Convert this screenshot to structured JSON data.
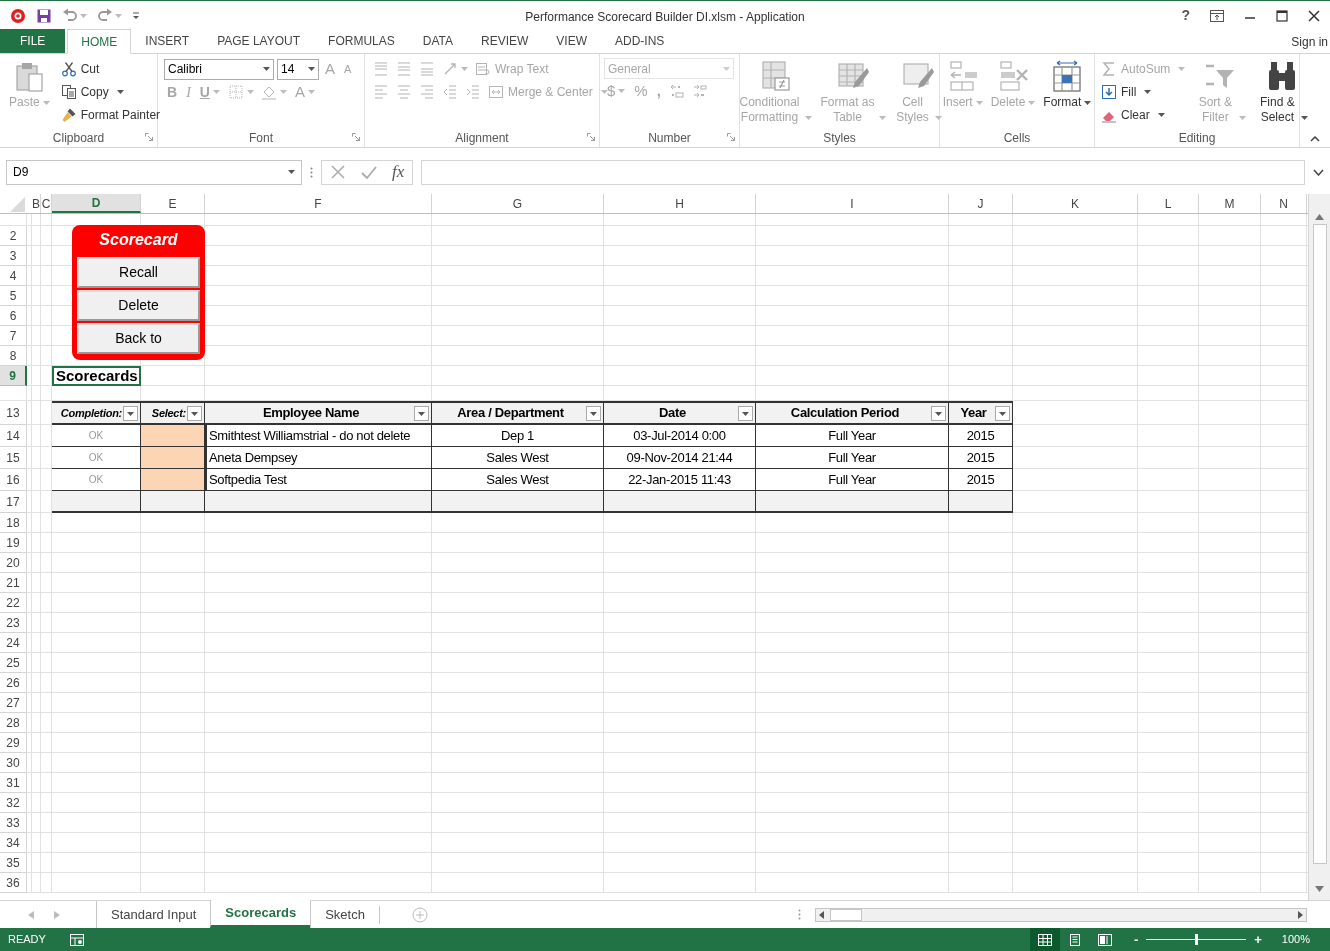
{
  "title_bar": {
    "title": "Performance Scorecard Builder DI.xlsm - Application",
    "help": "?"
  },
  "menu_tabs": [
    {
      "label": "FILE",
      "kind": "file",
      "selected": false
    },
    {
      "label": "HOME",
      "kind": "tab",
      "selected": true
    },
    {
      "label": "INSERT",
      "kind": "tab",
      "selected": false
    },
    {
      "label": "PAGE LAYOUT",
      "kind": "tab",
      "selected": false
    },
    {
      "label": "FORMULAS",
      "kind": "tab",
      "selected": false
    },
    {
      "label": "DATA",
      "kind": "tab",
      "selected": false
    },
    {
      "label": "REVIEW",
      "kind": "tab",
      "selected": false
    },
    {
      "label": "VIEW",
      "kind": "tab",
      "selected": false
    },
    {
      "label": "ADD-INS",
      "kind": "tab",
      "selected": false
    }
  ],
  "sign_in": "Sign in",
  "ribbon": [
    {
      "label": "Clipboard",
      "launcher": true,
      "columns": [
        [
          {
            "kind": "large",
            "label": "Paste",
            "disabled": true,
            "dropdown": true
          }
        ],
        [
          {
            "kind": "small",
            "label": "Cut",
            "disabled": false
          },
          {
            "kind": "small",
            "label": "Copy",
            "disabled": false,
            "dropdown": true
          },
          {
            "kind": "small",
            "label": "Format Painter",
            "disabled": false
          }
        ]
      ]
    },
    {
      "label": "Font",
      "launcher": true,
      "columns": [
        [
          {
            "kind": "row",
            "items": [
              {
                "kind": "field",
                "label": "Calibri"
              },
              {
                "kind": "field",
                "label": "14"
              },
              {
                "kind": "glyph",
                "label": "A",
                "disabled": true
              },
              {
                "kind": "glyph",
                "label": "A",
                "disabled": true
              }
            ]
          },
          {
            "kind": "row",
            "items": [
              {
                "kind": "glyph",
                "label": "B",
                "disabled": true
              },
              {
                "kind": "glyph",
                "label": "I",
                "disabled": true
              },
              {
                "kind": "glyph",
                "label": "U",
                "disabled": true,
                "dropdown": true
              },
              {
                "kind": "icon",
                "disabled": true,
                "dropdown": true
              },
              {
                "kind": "icon",
                "disabled": true,
                "dropdown": true
              },
              {
                "kind": "glyph",
                "label": "A",
                "disabled": true,
                "dropdown": true
              }
            ]
          }
        ]
      ]
    },
    {
      "label": "Alignment",
      "launcher": true,
      "columns": [
        [
          {
            "kind": "row",
            "items": [
              {
                "kind": "icon",
                "disabled": true
              },
              {
                "kind": "icon",
                "disabled": true
              },
              {
                "kind": "icon",
                "disabled": true
              },
              {
                "kind": "icon",
                "disabled": true,
                "dropdown": true
              },
              {
                "kind": "small",
                "label": "Wrap Text",
                "disabled": true
              }
            ]
          },
          {
            "kind": "row",
            "items": [
              {
                "kind": "icon",
                "disabled": true
              },
              {
                "kind": "icon",
                "disabled": true
              },
              {
                "kind": "icon",
                "disabled": true
              },
              {
                "kind": "icon",
                "disabled": true
              },
              {
                "kind": "icon",
                "disabled": true
              },
              {
                "kind": "small",
                "label": "Merge & Center",
                "disabled": true,
                "dropdown": true
              }
            ]
          }
        ]
      ]
    },
    {
      "label": "Number",
      "launcher": true,
      "columns": [
        [
          {
            "kind": "field",
            "label": "General",
            "disabled": true
          },
          {
            "kind": "row",
            "items": [
              {
                "kind": "glyph",
                "label": "$",
                "disabled": true,
                "dropdown": true
              },
              {
                "kind": "glyph",
                "label": "%",
                "disabled": true
              },
              {
                "kind": "glyph",
                "label": ",",
                "disabled": true
              },
              {
                "kind": "icon",
                "disabled": true
              },
              {
                "kind": "icon",
                "disabled": true
              }
            ]
          }
        ]
      ]
    },
    {
      "label": "Styles",
      "launcher": false,
      "columns": [
        [
          {
            "kind": "large",
            "label": "Conditional Formatting",
            "disabled": true,
            "dropdown": true
          }
        ],
        [
          {
            "kind": "large",
            "label": "Format as Table",
            "disabled": true,
            "dropdown": true
          }
        ],
        [
          {
            "kind": "large",
            "label": "Cell Styles",
            "disabled": true,
            "dropdown": true
          }
        ]
      ]
    },
    {
      "label": "Cells",
      "launcher": false,
      "columns": [
        [
          {
            "kind": "large",
            "label": "Insert",
            "disabled": true,
            "dropdown": true
          }
        ],
        [
          {
            "kind": "large",
            "label": "Delete",
            "disabled": true,
            "dropdown": true
          }
        ],
        [
          {
            "kind": "large",
            "label": "Format",
            "disabled": false,
            "dropdown": true
          }
        ]
      ]
    },
    {
      "label": "Editing",
      "launcher": false,
      "columns": [
        [
          {
            "kind": "small",
            "label": "AutoSum",
            "disabled": true,
            "dropdown": true
          },
          {
            "kind": "small",
            "label": "Fill",
            "disabled": false,
            "dropdown": true
          },
          {
            "kind": "small",
            "label": "Clear",
            "disabled": false,
            "dropdown": true
          }
        ],
        [
          {
            "kind": "large",
            "label": "Sort & Filter",
            "disabled": true,
            "dropdown": true
          }
        ],
        [
          {
            "kind": "large",
            "label": "Find & Select",
            "disabled": false,
            "dropdown": true
          }
        ]
      ]
    }
  ],
  "formula_bar": {
    "name_box": "D9",
    "function_label": "fx"
  },
  "sheet": {
    "columns": [
      {
        "label": "B",
        "selected": false
      },
      {
        "label": "C",
        "selected": false
      },
      {
        "label": "D",
        "selected": true
      },
      {
        "label": "E",
        "selected": false
      },
      {
        "label": "F",
        "selected": false
      },
      {
        "label": "G",
        "selected": false
      },
      {
        "label": "H",
        "selected": false
      },
      {
        "label": "I",
        "selected": false
      },
      {
        "label": "J",
        "selected": false
      },
      {
        "label": "K",
        "selected": false
      },
      {
        "label": "L",
        "selected": false
      },
      {
        "label": "M",
        "selected": false
      },
      {
        "label": "N",
        "selected": false
      }
    ],
    "rows": [
      {
        "label": "2",
        "selected": false
      },
      {
        "label": "3",
        "selected": false
      },
      {
        "label": "4",
        "selected": false
      },
      {
        "label": "5",
        "selected": false
      },
      {
        "label": "6",
        "selected": false
      },
      {
        "label": "7",
        "selected": false
      },
      {
        "label": "8",
        "selected": false
      },
      {
        "label": "9",
        "selected": true
      },
      {
        "label": "13",
        "selected": false
      },
      {
        "label": "14",
        "selected": false
      },
      {
        "label": "15",
        "selected": false
      },
      {
        "label": "16",
        "selected": false
      },
      {
        "label": "17",
        "selected": false
      },
      {
        "label": "18",
        "selected": false
      },
      {
        "label": "19",
        "selected": false
      },
      {
        "label": "20",
        "selected": false
      },
      {
        "label": "21",
        "selected": false
      },
      {
        "label": "22",
        "selected": false
      },
      {
        "label": "23",
        "selected": false
      },
      {
        "label": "24",
        "selected": false
      },
      {
        "label": "25",
        "selected": false
      },
      {
        "label": "26",
        "selected": false
      },
      {
        "label": "27",
        "selected": false
      },
      {
        "label": "28",
        "selected": false
      },
      {
        "label": "29",
        "selected": false
      },
      {
        "label": "30",
        "selected": false
      },
      {
        "label": "31",
        "selected": false
      },
      {
        "label": "32",
        "selected": false
      },
      {
        "label": "33",
        "selected": false
      },
      {
        "label": "34",
        "selected": false
      },
      {
        "label": "35",
        "selected": false
      },
      {
        "label": "36",
        "selected": false
      }
    ],
    "title_cell": {
      "text": "Scorecards",
      "selected": true
    },
    "macro_panel": {
      "title": "Scorecard",
      "buttons": [
        "Recall",
        "Delete",
        "Back to"
      ]
    },
    "table": {
      "columns": [
        "Completion:",
        "Select:",
        "Employee Name",
        "Area / Department",
        "Date",
        "Calculation Period",
        "Year"
      ],
      "rows": [
        {
          "completion": "OK",
          "employee": "Smithtest Williamstrial - do not delete",
          "area": "Dep 1",
          "date": "03-Jul-2014 0:00",
          "period": "Full Year",
          "year": "2015"
        },
        {
          "completion": "OK",
          "employee": "Aneta Dempsey",
          "area": "Sales West",
          "date": "09-Nov-2014 21:44",
          "period": "Full Year",
          "year": "2015"
        },
        {
          "completion": "OK",
          "employee": "Softpedia Test",
          "area": "Sales West",
          "date": "22-Jan-2015 11:43",
          "period": "Full Year",
          "year": "2015"
        }
      ]
    }
  },
  "sheet_tabs": [
    {
      "label": "Standard Input",
      "selected": false
    },
    {
      "label": "Scorecards",
      "selected": true
    },
    {
      "label": "Sketch",
      "selected": false
    }
  ],
  "status_bar": {
    "status": "READY",
    "views": [
      {
        "selected": true
      },
      {
        "selected": false
      },
      {
        "selected": false
      }
    ],
    "zoom_out": "-",
    "zoom_in": "+",
    "zoom": {
      "level": 0.5,
      "reading": "100%"
    }
  }
}
